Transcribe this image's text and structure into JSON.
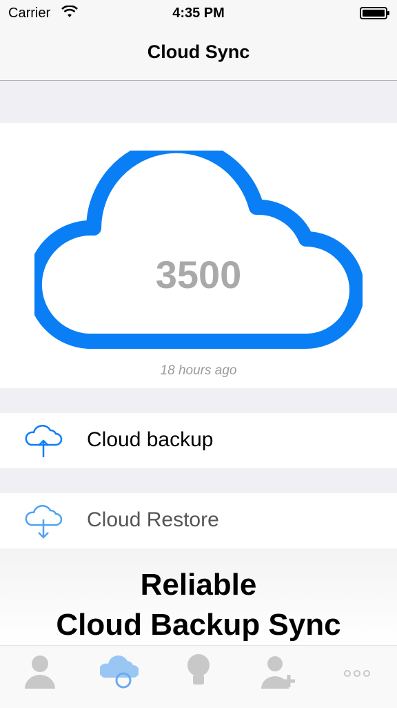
{
  "status_bar": {
    "carrier": "Carrier",
    "time": "4:35 PM"
  },
  "nav": {
    "title": "Cloud Sync"
  },
  "cloud": {
    "count": "3500",
    "last_sync": "18 hours ago"
  },
  "actions": {
    "backup_label": "Cloud backup",
    "restore_label": "Cloud Restore"
  },
  "promo": {
    "line1": "Reliable",
    "line2": "Cloud Backup Sync"
  },
  "tabs": [
    {
      "icon": "person-icon",
      "selected": false
    },
    {
      "icon": "cloud-sync-icon",
      "selected": true
    },
    {
      "icon": "lightbulb-icon",
      "selected": false
    },
    {
      "icon": "add-person-icon",
      "selected": false
    },
    {
      "icon": "more-icon",
      "selected": false
    }
  ],
  "colors": {
    "accent": "#0a7ff5",
    "count_text": "#a9a9a9",
    "background": "#efeff4",
    "tab_icon": "#c8c8c8"
  }
}
